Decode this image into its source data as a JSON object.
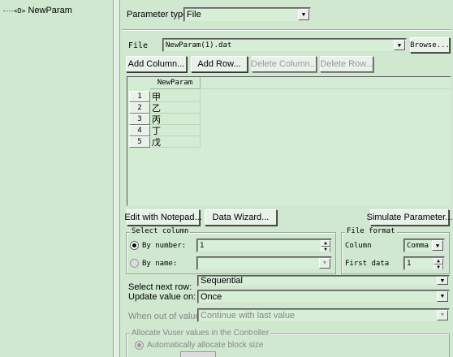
{
  "tree": {
    "item_prefix": "<D>",
    "item_label": "NewParam"
  },
  "param_type": {
    "label": "Parameter type:",
    "value": "File"
  },
  "file": {
    "label": "File",
    "value": "NewParam(1).dat",
    "browse_label": "Browse..."
  },
  "grid_buttons": {
    "add_column": "Add Column...",
    "add_row": "Add Row...",
    "delete_column": "Delete Column...",
    "delete_row": "Delete Row..."
  },
  "table": {
    "column_header": "NewParam",
    "rows": [
      {
        "num": "1",
        "value": "甲"
      },
      {
        "num": "2",
        "value": "乙"
      },
      {
        "num": "3",
        "value": "丙"
      },
      {
        "num": "4",
        "value": "丁"
      },
      {
        "num": "5",
        "value": "戊"
      }
    ]
  },
  "actions": {
    "edit_notepad": "Edit with Notepad...",
    "data_wizard": "Data Wizard...",
    "simulate": "Simulate Parameter..."
  },
  "select_column": {
    "title": "Select column",
    "by_number_label": "By number:",
    "by_number_value": "1",
    "by_name_label": "By name:"
  },
  "file_format": {
    "title": "File format",
    "column_label": "Column",
    "column_value": "Comma",
    "first_data_label": "First data",
    "first_data_value": "1"
  },
  "select_next_row": {
    "label": "Select next row:",
    "value": "Sequential"
  },
  "update_value": {
    "label": "Update value on:",
    "value": "Once"
  },
  "when_out": {
    "label": "When out of values:",
    "value": "Continue with last value"
  },
  "allocate": {
    "title": "Allocate Vuser values in the Controller",
    "auto_label": "Automatically allocate block size"
  }
}
